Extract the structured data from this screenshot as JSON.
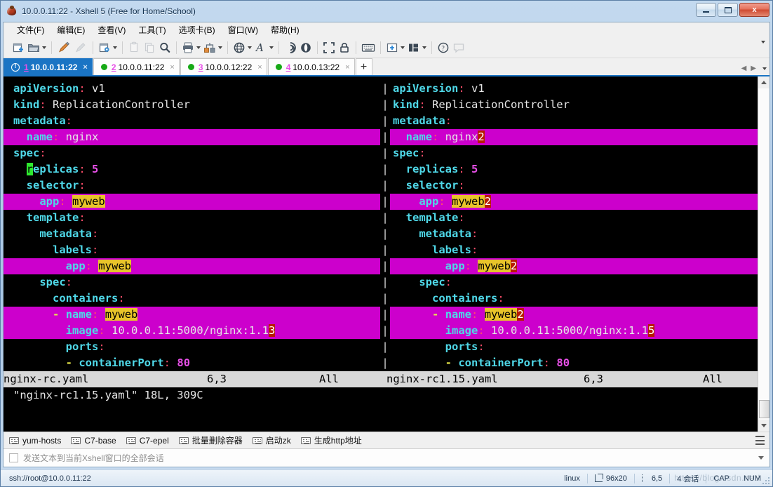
{
  "window": {
    "title": "10.0.0.11:22 - Xshell 5 (Free for Home/School)",
    "app_icon": "xshell-bean-icon",
    "minimize_label": "Minimize",
    "maximize_label": "Maximize",
    "close_label": "x"
  },
  "menubar": {
    "items": [
      {
        "label": "文件(F)",
        "name": "menu-file"
      },
      {
        "label": "编辑(E)",
        "name": "menu-edit"
      },
      {
        "label": "查看(V)",
        "name": "menu-view"
      },
      {
        "label": "工具(T)",
        "name": "menu-tools"
      },
      {
        "label": "选项卡(B)",
        "name": "menu-tabs"
      },
      {
        "label": "窗口(W)",
        "name": "menu-window"
      },
      {
        "label": "帮助(H)",
        "name": "menu-help"
      }
    ]
  },
  "toolbar": {
    "buttons": [
      {
        "icon": "new-session-icon",
        "disabled": false,
        "caret": false
      },
      {
        "icon": "open-folder-icon",
        "disabled": false,
        "caret": true
      },
      {
        "icon": "connect-plug-icon",
        "disabled": false,
        "caret": false
      },
      {
        "icon": "disconnect-plug-icon",
        "disabled": true,
        "caret": false
      },
      {
        "icon": "session-properties-icon",
        "disabled": false,
        "caret": true
      },
      {
        "icon": "copy-icon",
        "disabled": true,
        "caret": false
      },
      {
        "icon": "paste-icon",
        "disabled": true,
        "caret": false
      },
      {
        "icon": "find-icon",
        "disabled": false,
        "caret": false
      },
      {
        "icon": "print-icon",
        "disabled": false,
        "caret": true
      },
      {
        "icon": "file-transfer-icon",
        "disabled": false,
        "caret": true
      },
      {
        "icon": "globe-encoding-icon",
        "disabled": false,
        "caret": true
      },
      {
        "icon": "font-icon",
        "disabled": false,
        "caret": true
      },
      {
        "icon": "trace-route-icon",
        "disabled": false,
        "caret": false
      },
      {
        "icon": "tunnel-icon",
        "disabled": false,
        "caret": false
      },
      {
        "icon": "fullscreen-icon",
        "disabled": false,
        "caret": false
      },
      {
        "icon": "lock-icon",
        "disabled": false,
        "caret": false
      },
      {
        "icon": "keyboard-icon",
        "disabled": false,
        "caret": false
      },
      {
        "icon": "add-window-icon",
        "disabled": false,
        "caret": true
      },
      {
        "icon": "layout-icon",
        "disabled": false,
        "caret": true
      },
      {
        "icon": "help-icon",
        "disabled": false,
        "caret": false
      },
      {
        "icon": "comment-icon",
        "disabled": true,
        "caret": false
      }
    ]
  },
  "tabs": {
    "items": [
      {
        "num": "1",
        "label": "10.0.0.11:22",
        "active": true,
        "status": "warning",
        "close": "×"
      },
      {
        "num": "2",
        "label": "10.0.0.11:22",
        "active": false,
        "status": "connected",
        "close": "×"
      },
      {
        "num": "3",
        "label": "10.0.0.12:22",
        "active": false,
        "status": "connected",
        "close": "×"
      },
      {
        "num": "4",
        "label": "10.0.0.13:22",
        "active": false,
        "status": "connected",
        "close": "×"
      }
    ],
    "new_tab_label": "+"
  },
  "terminal": {
    "left_file": "nginx-rc.yaml",
    "right_file": "nginx-rc1.15.yaml",
    "rows": [
      {
        "diff": false,
        "left": [
          {
            "t": "apiVersion",
            "c": "k"
          },
          {
            "t": ":",
            "c": "p"
          },
          {
            "t": " v1",
            "c": "v"
          }
        ],
        "right": [
          {
            "t": "apiVersion",
            "c": "k"
          },
          {
            "t": ":",
            "c": "p"
          },
          {
            "t": " v1",
            "c": "v"
          }
        ]
      },
      {
        "diff": false,
        "left": [
          {
            "t": "kind",
            "c": "k"
          },
          {
            "t": ":",
            "c": "p"
          },
          {
            "t": " ReplicationController",
            "c": "v"
          }
        ],
        "right": [
          {
            "t": "kind",
            "c": "k"
          },
          {
            "t": ":",
            "c": "p"
          },
          {
            "t": " ReplicationController",
            "c": "v"
          }
        ]
      },
      {
        "diff": false,
        "left": [
          {
            "t": "metadata",
            "c": "k"
          },
          {
            "t": ":",
            "c": "p"
          }
        ],
        "right": [
          {
            "t": "metadata",
            "c": "k"
          },
          {
            "t": ":",
            "c": "p"
          }
        ]
      },
      {
        "diff": true,
        "left": [
          {
            "t": "  ",
            "c": "v"
          },
          {
            "t": "name",
            "c": "k"
          },
          {
            "t": ":",
            "c": "p"
          },
          {
            "t": " nginx",
            "c": "v"
          }
        ],
        "right": [
          {
            "t": "  ",
            "c": "v"
          },
          {
            "t": "name",
            "c": "k"
          },
          {
            "t": ":",
            "c": "p"
          },
          {
            "t": " nginx",
            "c": "v"
          },
          {
            "t": "2",
            "c": "diffchg"
          }
        ]
      },
      {
        "diff": false,
        "left": [
          {
            "t": "spec",
            "c": "k"
          },
          {
            "t": ":",
            "c": "p"
          }
        ],
        "right": [
          {
            "t": "spec",
            "c": "k"
          },
          {
            "t": ":",
            "c": "p"
          }
        ]
      },
      {
        "diff": false,
        "left": [
          {
            "t": "  ",
            "c": "v"
          },
          {
            "t": "r",
            "c": "cursor"
          },
          {
            "t": "eplicas",
            "c": "k"
          },
          {
            "t": ":",
            "c": "p"
          },
          {
            "t": " ",
            "c": "v"
          },
          {
            "t": "5",
            "c": "num"
          }
        ],
        "right": [
          {
            "t": "  ",
            "c": "v"
          },
          {
            "t": "replicas",
            "c": "k"
          },
          {
            "t": ":",
            "c": "p"
          },
          {
            "t": " ",
            "c": "v"
          },
          {
            "t": "5",
            "c": "num"
          }
        ]
      },
      {
        "diff": false,
        "left": [
          {
            "t": "  ",
            "c": "v"
          },
          {
            "t": "selector",
            "c": "k"
          },
          {
            "t": ":",
            "c": "p"
          }
        ],
        "right": [
          {
            "t": "  ",
            "c": "v"
          },
          {
            "t": "selector",
            "c": "k"
          },
          {
            "t": ":",
            "c": "p"
          }
        ]
      },
      {
        "diff": true,
        "left": [
          {
            "t": "    ",
            "c": "v"
          },
          {
            "t": "app",
            "c": "k"
          },
          {
            "t": ":",
            "c": "p"
          },
          {
            "t": " ",
            "c": "v"
          },
          {
            "t": "myweb",
            "c": "difftext"
          }
        ],
        "right": [
          {
            "t": "    ",
            "c": "v"
          },
          {
            "t": "app",
            "c": "k"
          },
          {
            "t": ":",
            "c": "p"
          },
          {
            "t": " ",
            "c": "v"
          },
          {
            "t": "myweb",
            "c": "difftext"
          },
          {
            "t": "2",
            "c": "diffchg"
          }
        ]
      },
      {
        "diff": false,
        "left": [
          {
            "t": "  ",
            "c": "v"
          },
          {
            "t": "template",
            "c": "k"
          },
          {
            "t": ":",
            "c": "p"
          }
        ],
        "right": [
          {
            "t": "  ",
            "c": "v"
          },
          {
            "t": "template",
            "c": "k"
          },
          {
            "t": ":",
            "c": "p"
          }
        ]
      },
      {
        "diff": false,
        "left": [
          {
            "t": "    ",
            "c": "v"
          },
          {
            "t": "metadata",
            "c": "k"
          },
          {
            "t": ":",
            "c": "p"
          }
        ],
        "right": [
          {
            "t": "    ",
            "c": "v"
          },
          {
            "t": "metadata",
            "c": "k"
          },
          {
            "t": ":",
            "c": "p"
          }
        ]
      },
      {
        "diff": false,
        "left": [
          {
            "t": "      ",
            "c": "v"
          },
          {
            "t": "labels",
            "c": "k"
          },
          {
            "t": ":",
            "c": "p"
          }
        ],
        "right": [
          {
            "t": "      ",
            "c": "v"
          },
          {
            "t": "labels",
            "c": "k"
          },
          {
            "t": ":",
            "c": "p"
          }
        ]
      },
      {
        "diff": true,
        "left": [
          {
            "t": "        ",
            "c": "v"
          },
          {
            "t": "app",
            "c": "k"
          },
          {
            "t": ":",
            "c": "p"
          },
          {
            "t": " ",
            "c": "v"
          },
          {
            "t": "myweb",
            "c": "difftext"
          }
        ],
        "right": [
          {
            "t": "        ",
            "c": "v"
          },
          {
            "t": "app",
            "c": "k"
          },
          {
            "t": ":",
            "c": "p"
          },
          {
            "t": " ",
            "c": "v"
          },
          {
            "t": "myweb",
            "c": "difftext"
          },
          {
            "t": "2",
            "c": "diffchg"
          }
        ]
      },
      {
        "diff": false,
        "left": [
          {
            "t": "    ",
            "c": "v"
          },
          {
            "t": "spec",
            "c": "k"
          },
          {
            "t": ":",
            "c": "p"
          }
        ],
        "right": [
          {
            "t": "    ",
            "c": "v"
          },
          {
            "t": "spec",
            "c": "k"
          },
          {
            "t": ":",
            "c": "p"
          }
        ]
      },
      {
        "diff": false,
        "left": [
          {
            "t": "      ",
            "c": "v"
          },
          {
            "t": "containers",
            "c": "k"
          },
          {
            "t": ":",
            "c": "p"
          }
        ],
        "right": [
          {
            "t": "      ",
            "c": "v"
          },
          {
            "t": "containers",
            "c": "k"
          },
          {
            "t": ":",
            "c": "p"
          }
        ]
      },
      {
        "diff": true,
        "left": [
          {
            "t": "      ",
            "c": "v"
          },
          {
            "t": "-",
            "c": "dash"
          },
          {
            "t": " ",
            "c": "v"
          },
          {
            "t": "name",
            "c": "k"
          },
          {
            "t": ":",
            "c": "p"
          },
          {
            "t": " ",
            "c": "v"
          },
          {
            "t": "myweb",
            "c": "difftext"
          }
        ],
        "right": [
          {
            "t": "      ",
            "c": "v"
          },
          {
            "t": "-",
            "c": "dash"
          },
          {
            "t": " ",
            "c": "v"
          },
          {
            "t": "name",
            "c": "k"
          },
          {
            "t": ":",
            "c": "p"
          },
          {
            "t": " ",
            "c": "v"
          },
          {
            "t": "myweb",
            "c": "difftext"
          },
          {
            "t": "2",
            "c": "diffchg"
          }
        ]
      },
      {
        "diff": true,
        "left": [
          {
            "t": "        ",
            "c": "v"
          },
          {
            "t": "image",
            "c": "k"
          },
          {
            "t": ":",
            "c": "p"
          },
          {
            "t": " 10.0.0.11:5000/nginx:1.1",
            "c": "v"
          },
          {
            "t": "3",
            "c": "diffchg"
          }
        ],
        "right": [
          {
            "t": "        ",
            "c": "v"
          },
          {
            "t": "image",
            "c": "k"
          },
          {
            "t": ":",
            "c": "p"
          },
          {
            "t": " 10.0.0.11:5000/nginx:1.1",
            "c": "v"
          },
          {
            "t": "5",
            "c": "diffchg"
          }
        ]
      },
      {
        "diff": false,
        "left": [
          {
            "t": "        ",
            "c": "v"
          },
          {
            "t": "ports",
            "c": "k"
          },
          {
            "t": ":",
            "c": "p"
          }
        ],
        "right": [
          {
            "t": "        ",
            "c": "v"
          },
          {
            "t": "ports",
            "c": "k"
          },
          {
            "t": ":",
            "c": "p"
          }
        ]
      },
      {
        "diff": false,
        "left": [
          {
            "t": "        ",
            "c": "v"
          },
          {
            "t": "-",
            "c": "dash"
          },
          {
            "t": " ",
            "c": "v"
          },
          {
            "t": "containerPort",
            "c": "k"
          },
          {
            "t": ":",
            "c": "p"
          },
          {
            "t": " ",
            "c": "v"
          },
          {
            "t": "80",
            "c": "num"
          }
        ],
        "right": [
          {
            "t": "        ",
            "c": "v"
          },
          {
            "t": "-",
            "c": "dash"
          },
          {
            "t": " ",
            "c": "v"
          },
          {
            "t": "containerPort",
            "c": "k"
          },
          {
            "t": ":",
            "c": "p"
          },
          {
            "t": " ",
            "c": "v"
          },
          {
            "t": "80",
            "c": "num"
          }
        ]
      }
    ],
    "status_left": {
      "file": "nginx-rc.yaml",
      "position": "6,3",
      "scroll": "All"
    },
    "status_right": {
      "file": "nginx-rc1.15.yaml",
      "position": "6,3",
      "scroll": "All"
    },
    "message_line": "\"nginx-rc1.15.yaml\" 18L, 309C",
    "separator_char": "|"
  },
  "bookmarks": {
    "items": [
      {
        "label": "yum-hosts",
        "icon": "keyboard-macro-icon"
      },
      {
        "label": "C7-base",
        "icon": "keyboard-macro-icon"
      },
      {
        "label": "C7-epel",
        "icon": "keyboard-macro-icon"
      },
      {
        "label": "批量删除容器",
        "icon": "keyboard-macro-icon"
      },
      {
        "label": "启动zk",
        "icon": "keyboard-macro-icon"
      },
      {
        "label": "生成http地址",
        "icon": "keyboard-macro-icon"
      }
    ]
  },
  "sendall": {
    "label": "发送文本到当前Xshell窗口的全部会话",
    "checked": false
  },
  "statusbar": {
    "connection": "ssh://root@10.0.0.11:22",
    "term_type": "linux",
    "size": "96x20",
    "cursor": "6,5",
    "sessions": "4 会话",
    "caps": "CAP",
    "num": "NUM",
    "watermark": "https://blog.csdn.net/"
  },
  "colors": {
    "accent": "#1a74c4",
    "titlebar_text": "#12304e",
    "terminal_bg": "#000000",
    "diff_line": "#cc00cc",
    "diff_text": "#e8c42a",
    "diff_change": "#b81b00",
    "cursor": "#2ee82e",
    "key": "#4fd8e8",
    "punct": "#ff4d6a",
    "number": "#e850e8",
    "dash": "#e8e84a",
    "connected_dot": "#16a916",
    "close_button": "#cf4a31"
  }
}
